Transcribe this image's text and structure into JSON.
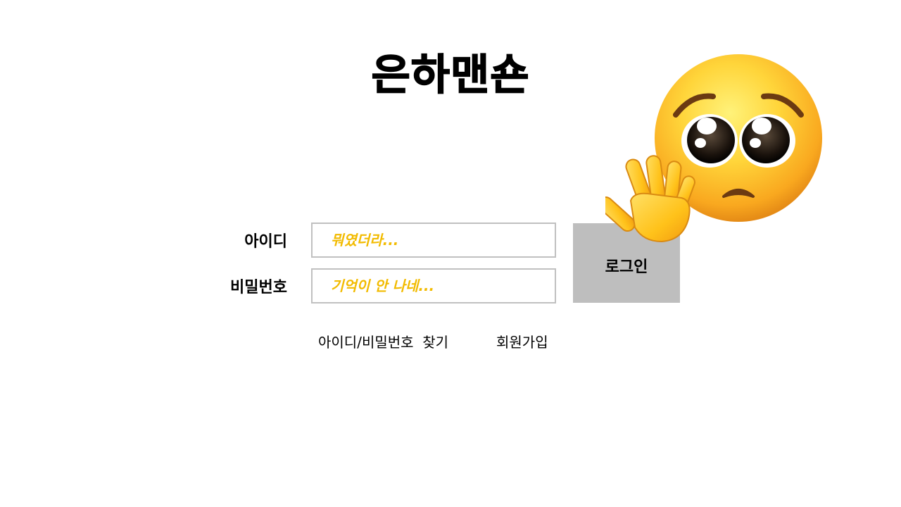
{
  "app": {
    "title": "은하맨숀"
  },
  "login_form": {
    "id_label": "아이디",
    "id_placeholder": "뭐였더라...",
    "password_label": "비밀번호",
    "password_placeholder": "기억이 안 나네...",
    "login_button": "로그인"
  },
  "footer_links": {
    "find_account": "아이디/비밀번호  찾기",
    "sign_up": "회원가입"
  },
  "decorations": {
    "face_icon": "pleading-face-icon",
    "hand_icon": "raised-hand-icon"
  },
  "colors": {
    "placeholder": "#f2bb00",
    "input_border": "#c0c0c0",
    "button_bg": "#bebebe"
  }
}
